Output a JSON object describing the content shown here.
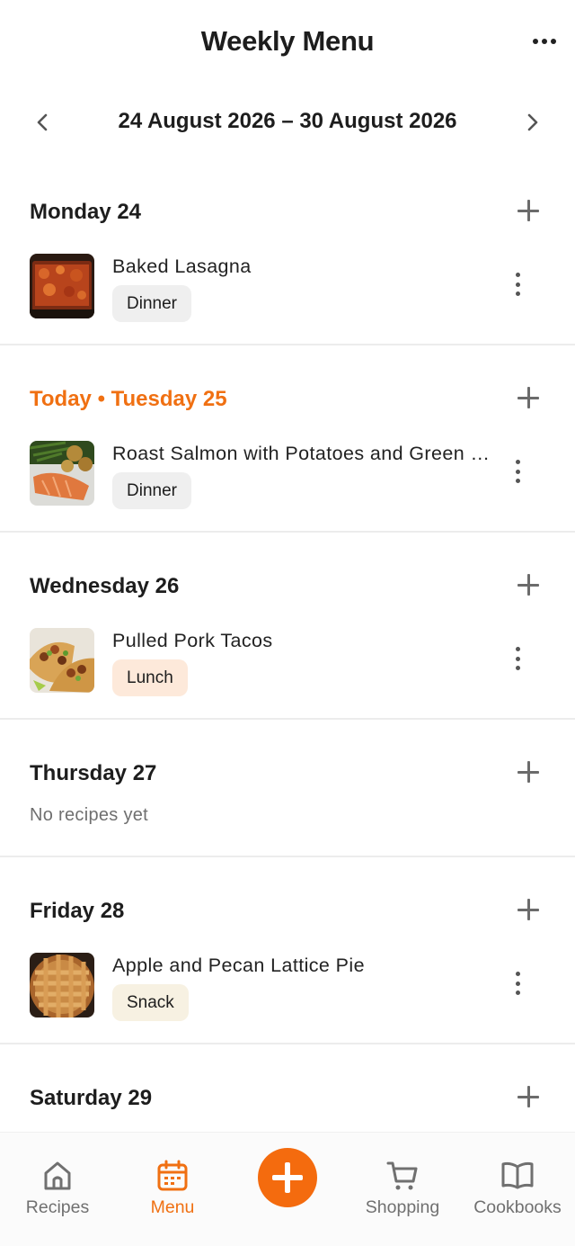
{
  "header": {
    "title": "Weekly Menu",
    "more_icon": "more-horizontal-icon"
  },
  "week": {
    "range": "24 August 2026 – 30 August 2026",
    "prev_icon": "chevron-left-icon",
    "next_icon": "chevron-right-icon"
  },
  "colors": {
    "accent": "#f07012",
    "dinner_tag": "#efefef",
    "lunch_tag": "#fde9da",
    "snack_tag": "#f7f1e2"
  },
  "days": [
    {
      "title": "Monday 24",
      "recipe": {
        "name": "Baked Lasagna",
        "tag": "Dinner",
        "tag_color": "#efefef",
        "image": "lasagna"
      }
    },
    {
      "title": "Today • Tuesday 25",
      "recipe": {
        "name": "Roast Salmon with Potatoes and Green Beans",
        "tag": "Dinner",
        "tag_color": "#efefef",
        "image": "salmon"
      }
    },
    {
      "title": "Wednesday 26",
      "recipe": {
        "name": "Pulled Pork Tacos",
        "tag": "Lunch",
        "tag_color": "#fde9da",
        "image": "tacos"
      }
    },
    {
      "title": "Thursday 27",
      "empty_text": "No recipes yet"
    },
    {
      "title": "Friday 28",
      "recipe": {
        "name": "Apple and Pecan Lattice Pie",
        "tag": "Snack",
        "tag_color": "#f7f1e2",
        "image": "pie"
      }
    },
    {
      "title": "Saturday 29"
    }
  ],
  "bottom_nav": {
    "recipes": {
      "label": "Recipes",
      "icon": "home-icon"
    },
    "menu": {
      "label": "Menu",
      "icon": "calendar-icon"
    },
    "add": {
      "icon": "plus-icon"
    },
    "shopping": {
      "label": "Shopping",
      "icon": "cart-icon"
    },
    "cookbooks": {
      "label": "Cookbooks",
      "icon": "book-icon"
    }
  }
}
